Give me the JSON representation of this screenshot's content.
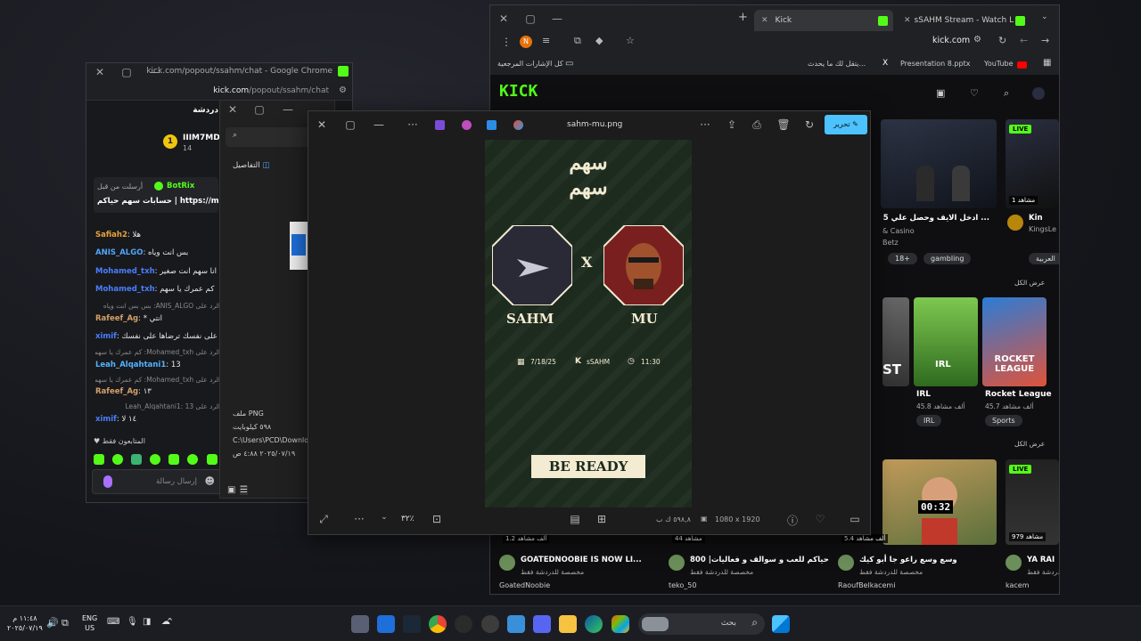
{
  "chat_window": {
    "title": "kick.com/popout/ssahm/chat - Google Chrome",
    "url_domain": "kick.com",
    "url_path": "/popout/ssahm/chat",
    "header": "دردشة",
    "top_user": "IIIM7MD",
    "top_user_count": "14",
    "pinned_meta": "أرسلت من قبل",
    "pinned_user": "BotRix",
    "pinned_text": "حسابات سهم حياكم | https://mh0.ca",
    "messages": [
      {
        "user": "Safiah2",
        "text": "هلا",
        "color": "#e6a23c"
      },
      {
        "user": "ANIS_ALGO",
        "text": "بس انت وياه",
        "color": "#4fa6ff"
      },
      {
        "user": "Mohamed_txh",
        "text": "انا سهم انت صغير",
        "color": "#4a7dff"
      },
      {
        "user": "Mohamed_txh",
        "text": "كم عمرك يا سهم",
        "color": "#4a7dff"
      },
      {
        "user": "",
        "text": "الرد على ANIS_ALGO: بس بس انت وياه",
        "color": "#888"
      },
      {
        "user": "Rafeef_Ag",
        "text": "* انتي",
        "color": "#d4a06a"
      },
      {
        "user": "ximif",
        "text": "استح على نفسك ترضاها على نفسك",
        "color": "#4a7dff"
      },
      {
        "user": "",
        "text": "الرد على Mohamed_txh: كم عمرك يا سهم",
        "color": "#888"
      },
      {
        "user": "Leah_Alqahtani1",
        "text": "13",
        "color": "#53b3ff"
      },
      {
        "user": "",
        "text": "الرد على Mohamed_txh: كم عمرك يا سهم",
        "color": "#888"
      },
      {
        "user": "Rafeef_Ag",
        "text": "١٣",
        "color": "#d4a06a"
      },
      {
        "user": "",
        "text": "الرد على Leah_Alqahtani1: 13",
        "color": "#888"
      },
      {
        "user": "ximif",
        "text": "١٤ لا",
        "color": "#4a7dff"
      }
    ],
    "followers_only": "المتابعون فقط",
    "input_placeholder": "إرسال رسالة"
  },
  "properties_panel": {
    "search_placeholder": "sahm",
    "details_label": "التفاصيل",
    "file_type": "ملف PNG",
    "file_size": "٥٩٨ كيلوبايت",
    "file_path": "C:\\Users\\PCD\\Download",
    "file_date": "٢٠٢٥/٠٧/١٩ ٤:٨٨ ص"
  },
  "viewer": {
    "filename": "sahm-mu.png",
    "edit_label": "تحرير",
    "zoom": "٣٢٪",
    "dimensions": "1080 x 1920",
    "size": "٥٩٨,٨ ك ب",
    "poster": {
      "logo_text": "سهم سهم",
      "left_name": "SAHM",
      "right_name": "MU",
      "vs": "X",
      "date": "7/18/25",
      "channel": "sSAHM",
      "time": "11:30",
      "cta": "BE READY"
    }
  },
  "browser": {
    "tab1": "Kick",
    "tab2": "sSAHM Stream - Watch Live on",
    "url": "kick.com",
    "bookmarks": [
      "كل الإشارات المرجعية",
      "يتقل لك ما يحدث...",
      "Presentation 8.pptx",
      "YouTube"
    ],
    "logo": "KICK",
    "row1": {
      "live_badge": "LIVE",
      "viewers": "1 مشاهد",
      "title": "... ادخل الايف وحصل علي 35 دولا",
      "sub1": "& Casino",
      "sub2": "Betz",
      "tag1": "18+",
      "tag2": "gambling",
      "right_name": "Kin",
      "right_sub": "KingsLe",
      "right_tag": "العربية"
    },
    "show_all": "عرض الكل",
    "categories": [
      {
        "name": "IRL",
        "viewers": "45.8 ألف مشاهد",
        "tag": "IRL"
      },
      {
        "name": "Rocket League",
        "viewers": "45.7 ألف مشاهد",
        "tag": "Sports"
      }
    ],
    "partial_cat": "ST",
    "row3": {
      "timer": "00:32",
      "live": "LIVE",
      "viewers": "979 مشاهد",
      "right_name": "YA RA"
    },
    "bottom_streams": [
      {
        "title": "GOATEDNOOBIE IS NOW LI...",
        "sub": "مخصصة للدردشة فقط",
        "user": "GoatedNoobie",
        "viewers": "1.2 ألف مشاهد"
      },
      {
        "title": "بث يديد حياكم للعب و سوالف و فعاليات| 800",
        "sub": "مخصصة للدردشة فقط",
        "user": "teko_50",
        "viewers": "44 مشاهد"
      },
      {
        "title": "وسع وسع راعو جا أبو كيك",
        "sub": "مخصصة للدردشة فقط",
        "user": "RaoufBelkacemi",
        "viewers": "5.4 ألف مشاهد"
      },
      {
        "title": "YA RAI",
        "sub": "الدردشة فقط",
        "user": "kacem",
        "viewers": ""
      }
    ]
  },
  "taskbar": {
    "time": "١١:٤٨ م",
    "date": "٢٠٢٥/٠٧/١٩",
    "lang": "ENG",
    "region": "US",
    "search_placeholder": "بحث"
  }
}
